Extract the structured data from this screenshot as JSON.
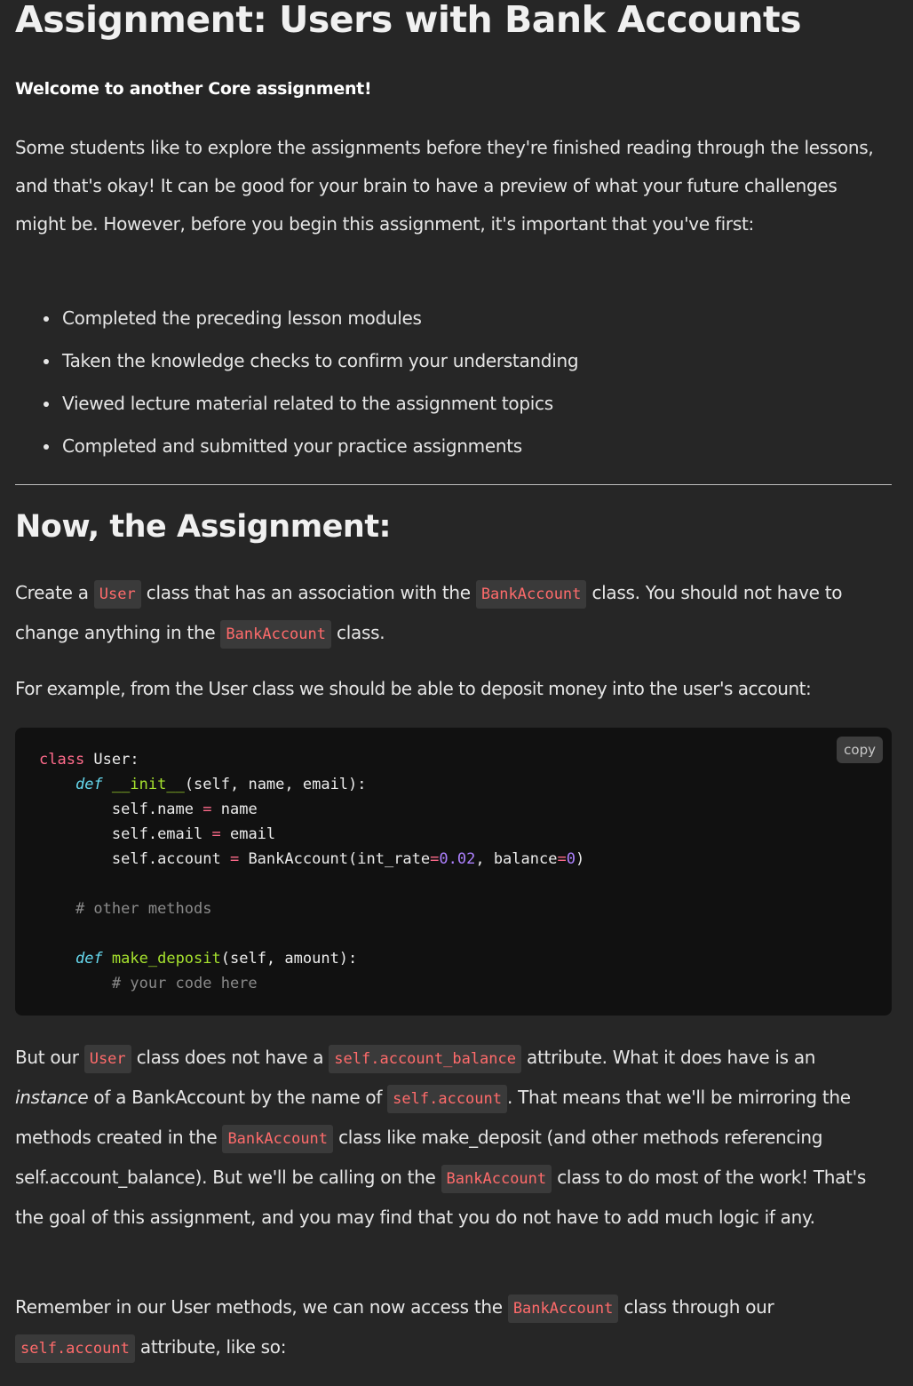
{
  "title": "Assignment: Users with Bank Accounts",
  "welcome": "Welcome to another Core assignment!",
  "intro": "Some students like to explore the assignments before they're finished reading through the lessons, and that's okay! It can be good for your brain to have a preview of what your future challenges might be. However, before you begin this assignment, it's important that you've first:",
  "bullets": [
    "Completed the preceding lesson modules",
    "Taken the knowledge checks to confirm your understanding",
    "Viewed lecture material related to the assignment topics",
    "Completed and submitted your practice assignments"
  ],
  "section_title": "Now, the Assignment:",
  "create": {
    "t1": "Create a ",
    "c1": "User",
    "t2": " class that has an association with the ",
    "c2": "BankAccount",
    "t3": " class. You should not have to change anything in the ",
    "c3": "BankAccount",
    "t4": " class."
  },
  "example": "For example, from the User class we should be able to deposit money into the user's account:",
  "code": {
    "copy_label": "copy",
    "l1_kw": "class",
    "l1_rest": " User:",
    "l2_def": "def",
    "l2_name": "__init__",
    "l2_rest": "(self, name, email):",
    "l3_a": "self.name ",
    "l3_op": "=",
    "l3_b": " name",
    "l4_a": "self.email ",
    "l4_op": "=",
    "l4_b": " email",
    "l5_a": "self.account ",
    "l5_op": "=",
    "l5_b": " BankAccount(int_rate",
    "l5_op2": "=",
    "l5_n1": "0.02",
    "l5_c": ", balance",
    "l5_op3": "=",
    "l5_n2": "0",
    "l5_d": ")",
    "l7_comment": "# other methods",
    "l9_def": "def",
    "l9_name": "make_deposit",
    "l9_rest": "(self, amount):",
    "l10_comment": "# your code here"
  },
  "butour": {
    "t1": "But our ",
    "c1": "User",
    "t2": " class does not have a ",
    "c2": "self.account_balance",
    "t3": " attribute. What it does have is an ",
    "em": "instance",
    "t4": " of a BankAccount by the name of ",
    "c3": "self.account",
    "t5": ". That means that we'll be mirroring the methods created in the ",
    "c4": "BankAccount",
    "t6": " class like make_deposit (and other methods referencing self.account_balance). But we'll be calling on the ",
    "c5": "BankAccount",
    "t7": " class to do most of the work! That's the goal of this assignment, and you may find that you do not have to add much logic if any."
  },
  "remember": {
    "t1": "Remember in our User methods, we can now access the ",
    "c1": "BankAccount",
    "t2": " class through our ",
    "c2": "self.account",
    "t3": " attribute, like so:"
  }
}
